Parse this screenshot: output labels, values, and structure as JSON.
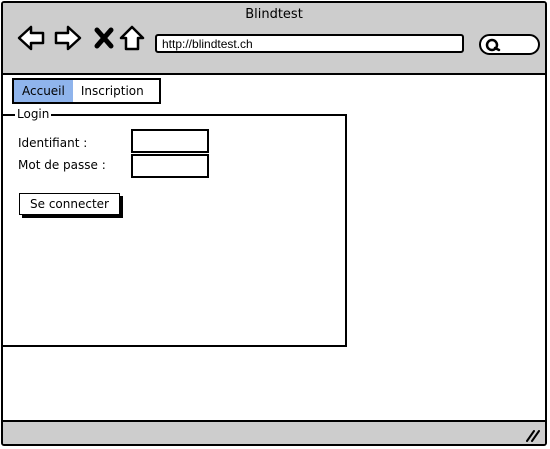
{
  "window": {
    "title": "Blindtest"
  },
  "toolbar": {
    "back_icon": "arrow-left-icon",
    "forward_icon": "arrow-right-icon",
    "stop_icon": "close-x-icon",
    "home_icon": "home-icon",
    "search_icon": "search-icon",
    "url": "http://blindtest.ch"
  },
  "tabs": [
    {
      "label": "Accueil",
      "active": true
    },
    {
      "label": "Inscription",
      "active": false
    }
  ],
  "login": {
    "legend": "Login",
    "username_label": "Identifiant :",
    "username_value": "",
    "password_label": "Mot de passe :",
    "password_value": "",
    "submit_label": "Se connecter"
  },
  "statusbar": {
    "grip_icon": "resize-grip-icon"
  },
  "colors": {
    "chrome": "#cdcdcd",
    "active_tab": "#8fb4ec",
    "border": "#000000",
    "background": "#ffffff"
  }
}
